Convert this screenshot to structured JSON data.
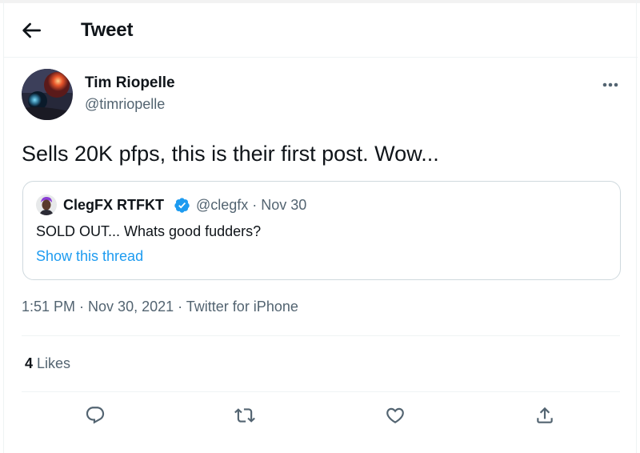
{
  "header": {
    "title": "Tweet"
  },
  "tweet": {
    "author_name": "Tim Riopelle",
    "author_handle": "@timriopelle",
    "text": "Sells 20K pfps, this is their first post. Wow...",
    "time": "1:51 PM",
    "separator": " · ",
    "date": "Nov 30, 2021",
    "source": "Twitter for iPhone",
    "likes_count": "4",
    "likes_label": "Likes"
  },
  "quoted": {
    "author_name": "ClegFX RTFKT",
    "verified": true,
    "meta": "@clegfx · Nov 30",
    "text": "SOLD OUT... Whats good fudders?",
    "show_thread": "Show this thread"
  },
  "icons": {
    "back": "back-arrow-icon",
    "more": "more-dots-icon",
    "verified": "verified-badge-icon",
    "reply": "reply-icon",
    "retweet": "retweet-icon",
    "like": "like-heart-icon",
    "share": "share-icon"
  },
  "colors": {
    "text": "#0f1419",
    "secondary": "#536471",
    "accent": "#1d9bf0",
    "border": "#cfd9de",
    "divider": "#eff3f4"
  }
}
